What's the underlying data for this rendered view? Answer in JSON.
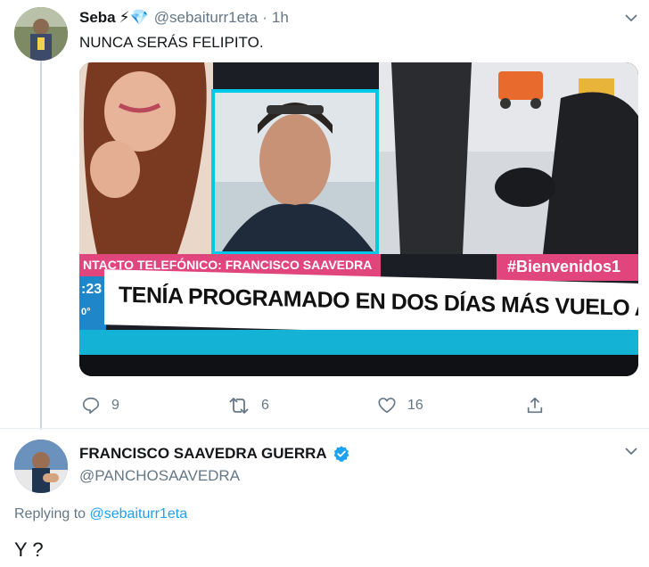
{
  "tweet": {
    "author_name": "Seba",
    "author_emojis": "⚡💎",
    "handle": "@sebaiturr1eta",
    "separator": "·",
    "time": "1h",
    "text": "NUNCA SERÁS FELIPITO.",
    "media": {
      "contact_label": "NTACTO TELEFÓNICO: FRANCISCO SAAVEDRA",
      "hashtag": "#Bienvenidos1",
      "clock": ":23",
      "temp": "0°",
      "headline": "TENÍA PROGRAMADO EN DOS DÍAS MÁS VUELO A LA ANTÁRTICA"
    },
    "actions": {
      "replies": "9",
      "retweets": "6",
      "likes": "16"
    }
  },
  "reply": {
    "author_name": "FRANCISCO SAAVEDRA GUERRA",
    "handle": "@PANCHOSAAVEDRA",
    "replying_prefix": "Replying to",
    "replying_to": "@sebaiturr1eta",
    "text": "Y ?"
  },
  "colors": {
    "text": "#14171a",
    "muted": "#657786",
    "link": "#1da1f2",
    "pink": "#e0457b",
    "cyan": "#14b3d6",
    "verified": "#1da1f2"
  }
}
